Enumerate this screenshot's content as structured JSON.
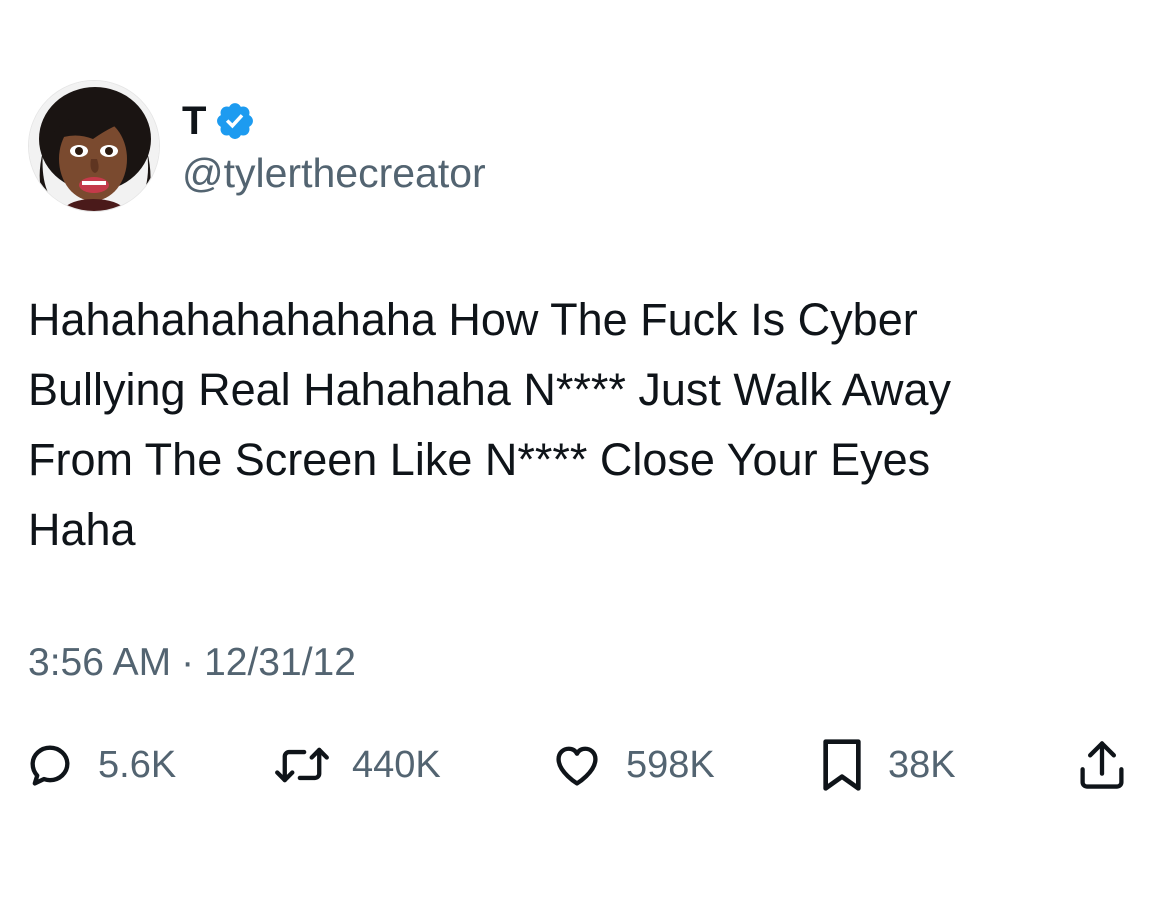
{
  "user": {
    "display_name": "T",
    "handle": "@tylerthecreator",
    "verified": true,
    "verified_color": "#1d9bf0",
    "avatar_icon": "avatar-photo"
  },
  "tweet": {
    "lines": [
      "Hahahahahahahaha How The Fuck Is Cyber",
      "Bullying Real Hahahaha N****  Just Walk Away",
      "From The Screen Like N****  Close Your Eyes",
      "Haha"
    ],
    "time": "3:56 AM",
    "separator": "·",
    "date": "12/31/12"
  },
  "actions": {
    "reply": {
      "icon": "reply-icon",
      "count": "5.6K"
    },
    "retweet": {
      "icon": "retweet-icon",
      "count": "440K"
    },
    "like": {
      "icon": "heart-icon",
      "count": "598K"
    },
    "bookmark": {
      "icon": "bookmark-icon",
      "count": "38K"
    },
    "share": {
      "icon": "share-icon"
    }
  },
  "colors": {
    "text_primary": "#0f1419",
    "text_secondary": "#536471",
    "background": "#ffffff"
  }
}
